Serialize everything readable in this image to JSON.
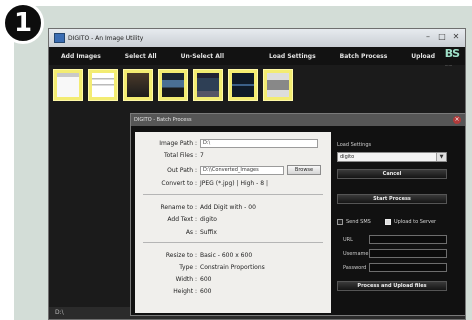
{
  "badge": {
    "number": "1"
  },
  "window": {
    "title": "DIGITO - An Image Utility",
    "controls": {
      "minimize": "–",
      "maximize": "□",
      "close": "✕"
    }
  },
  "toolbar": {
    "add_images": "Add Images",
    "select_all": "Select All",
    "unselect_all": "Un-Select All",
    "load_settings": "Load Settings",
    "batch_process": "Batch Process",
    "upload": "Upload"
  },
  "logo": {
    "text": "BS",
    "sub": "......"
  },
  "thumbnails": [
    "img-white",
    "img-doc",
    "img-dark",
    "img-ui",
    "img-screen",
    "img-blue",
    "img-gray"
  ],
  "statusbar": {
    "text": "D:\\"
  },
  "dialog": {
    "title": "DIGITO - Batch Process",
    "image_path": {
      "label": "Image Path :",
      "value": "D:\\"
    },
    "total_files": {
      "label": "Total Files :",
      "value": "7"
    },
    "out_path": {
      "label": "Out Path :",
      "value": "D:\\\\Converted_Images",
      "browse": "Browse"
    },
    "convert_to": {
      "label": "Convert to :",
      "value": "JPEG (*.jpg) | High - 8 |"
    },
    "rename_to": {
      "label": "Rename to :",
      "value": "Add Digit with - 00"
    },
    "add_text": {
      "label": "Add Text :",
      "value": "digito"
    },
    "as": {
      "label": "As :",
      "value": "Suffix"
    },
    "resize_to": {
      "label": "Resize to :",
      "value": "Basic - 600 x 600"
    },
    "type": {
      "label": "Type :",
      "value": "Constrain Proportions"
    },
    "width": {
      "label": "Width :",
      "value": "600"
    },
    "height": {
      "label": "Height :",
      "value": "600"
    },
    "right": {
      "load_settings_label": "Load Settings",
      "selected_setting": "digito",
      "cancel": "Cancel",
      "start_process": "Start Process",
      "send_sms": "Send SMS",
      "upload_to_server": "Upload to Server",
      "url": "URL",
      "username": "Username",
      "password": "Password",
      "process_and_upload": "Process and Upload files"
    }
  }
}
